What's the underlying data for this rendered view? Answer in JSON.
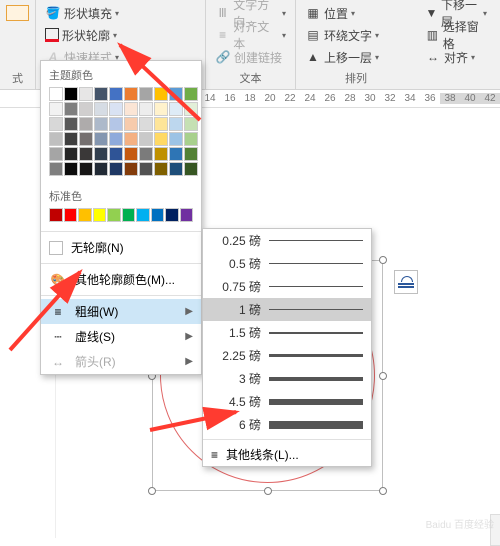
{
  "ribbon": {
    "shape_fill": "形状填充",
    "shape_outline": "形状轮廓",
    "quick_styles": "快速样式",
    "text_dir": "文字方向",
    "align_text": "对齐文本",
    "create_link": "创建链接",
    "position": "位置",
    "wrap_text": "环绕文字",
    "send_back_one": "下移一层",
    "bring_fwd_one": "上移一层",
    "selection_pane": "选择窗格",
    "align": "对齐",
    "group_text": "文本",
    "group_arrange": "排列",
    "group_shape_styles": "式"
  },
  "ruler": {
    "ticks": [
      "14",
      "16",
      "18",
      "20",
      "22",
      "24",
      "26",
      "28",
      "30",
      "32",
      "34",
      "36",
      "38",
      "40",
      "42"
    ]
  },
  "dropdown": {
    "theme_colors": "主题颜色",
    "standard_colors": "标准色",
    "no_outline": "无轮廓(N)",
    "more_colors": "其他轮廓颜色(M)...",
    "weight": "粗细(W)",
    "dashes": "虚线(S)",
    "arrows": "箭头(R)",
    "theme_row1": [
      "#ffffff",
      "#000000",
      "#e7e6e6",
      "#44546a",
      "#4472c4",
      "#ed7d31",
      "#a5a5a5",
      "#ffc000",
      "#5b9bd5",
      "#70ad47"
    ],
    "theme_tints": [
      [
        "#f2f2f2",
        "#7f7f7f",
        "#d0cece",
        "#d6dce4",
        "#d9e2f3",
        "#fbe5d5",
        "#ededed",
        "#fff2cc",
        "#deebf6",
        "#e2efd9"
      ],
      [
        "#d8d8d8",
        "#595959",
        "#aeabab",
        "#adb9ca",
        "#b4c6e7",
        "#f7cbac",
        "#dbdbdb",
        "#fee599",
        "#bdd7ee",
        "#c5e0b3"
      ],
      [
        "#bfbfbf",
        "#3f3f3f",
        "#757070",
        "#8496b0",
        "#8eaadb",
        "#f4b183",
        "#c9c9c9",
        "#ffd965",
        "#9cc3e5",
        "#a8d08d"
      ],
      [
        "#a5a5a5",
        "#262626",
        "#3a3838",
        "#323f4f",
        "#2f5496",
        "#c55a11",
        "#7b7b7b",
        "#bf9000",
        "#2e75b5",
        "#538135"
      ],
      [
        "#7f7f7f",
        "#0c0c0c",
        "#171616",
        "#222a35",
        "#1f3864",
        "#833c0b",
        "#525252",
        "#7f6000",
        "#1e4e79",
        "#375623"
      ]
    ],
    "standard": [
      "#c00000",
      "#ff0000",
      "#ffc000",
      "#ffff00",
      "#92d050",
      "#00b050",
      "#00b0f0",
      "#0070c0",
      "#002060",
      "#7030a0"
    ]
  },
  "weights": {
    "items": [
      {
        "label": "0.25 磅",
        "px": 0.5
      },
      {
        "label": "0.5 磅",
        "px": 1
      },
      {
        "label": "0.75 磅",
        "px": 1
      },
      {
        "label": "1 磅",
        "px": 1.5
      },
      {
        "label": "1.5 磅",
        "px": 2
      },
      {
        "label": "2.25 磅",
        "px": 3
      },
      {
        "label": "3 磅",
        "px": 4
      },
      {
        "label": "4.5 磅",
        "px": 6
      },
      {
        "label": "6 磅",
        "px": 8
      }
    ],
    "more": "其他线条(L)...",
    "selected_index": 3
  },
  "colors": {
    "brand_blue": "#2b579a",
    "accent_red": "#e81123",
    "arrow_red": "#ff3b30"
  }
}
